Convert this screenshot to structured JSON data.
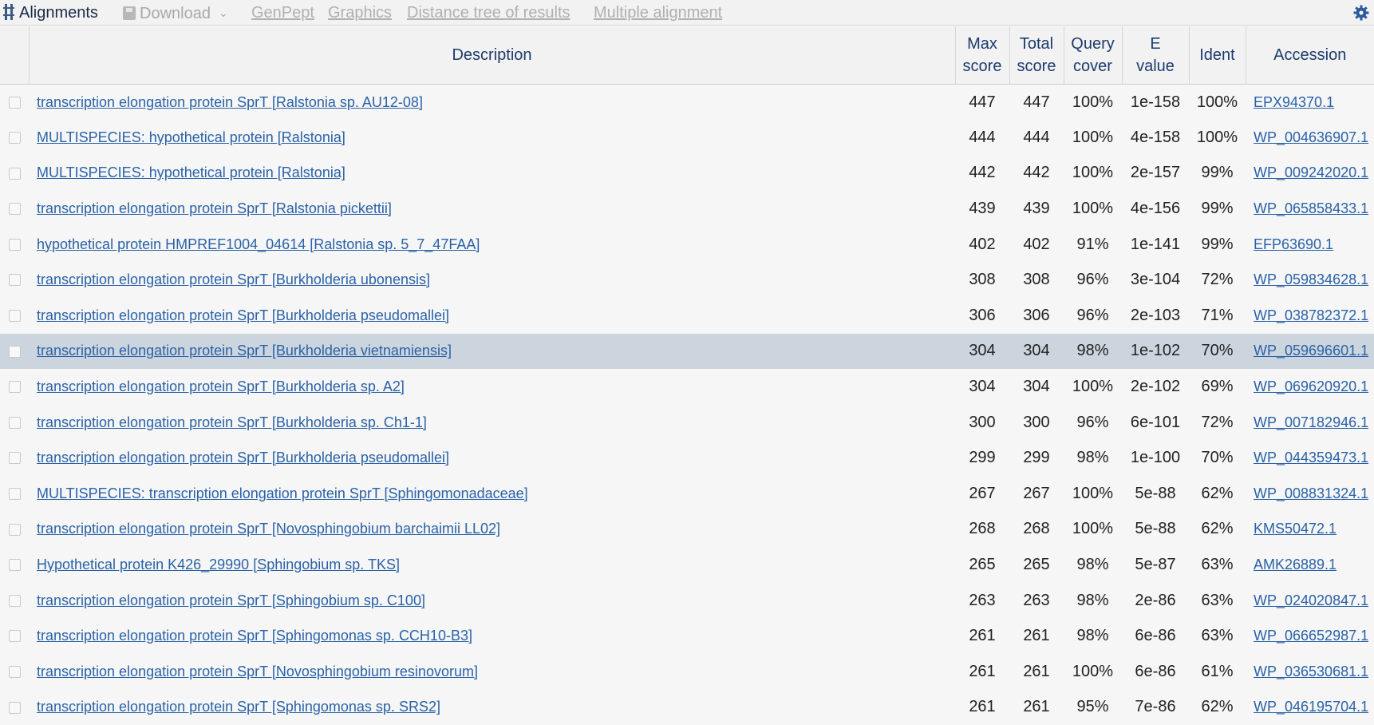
{
  "toolbar": {
    "title": "Alignments",
    "download": "Download",
    "links": [
      "GenPept",
      "Graphics",
      "Distance tree of results",
      "Multiple alignment"
    ]
  },
  "columns": {
    "description": "Description",
    "max_score": [
      "Max",
      "score"
    ],
    "total_score": [
      "Total",
      "score"
    ],
    "query_cover": [
      "Query",
      "cover"
    ],
    "e_value": [
      "E",
      "value"
    ],
    "ident": "Ident",
    "accession": "Accession"
  },
  "colors": {
    "link": "#2a62a8",
    "header_text": "#1d3b6e",
    "highlight_row": "#ccd5de"
  },
  "rows": [
    {
      "description": "transcription elongation protein SprT [Ralstonia sp. AU12-08]",
      "max": "447",
      "total": "447",
      "cover": "100%",
      "evalue": "1e-158",
      "ident": "100%",
      "accession": "EPX94370.1"
    },
    {
      "description": "MULTISPECIES: hypothetical protein [Ralstonia]",
      "max": "444",
      "total": "444",
      "cover": "100%",
      "evalue": "4e-158",
      "ident": "100%",
      "accession": "WP_004636907.1"
    },
    {
      "description": "MULTISPECIES: hypothetical protein [Ralstonia]",
      "max": "442",
      "total": "442",
      "cover": "100%",
      "evalue": "2e-157",
      "ident": "99%",
      "accession": "WP_009242020.1"
    },
    {
      "description": "transcription elongation protein SprT [Ralstonia pickettii]",
      "max": "439",
      "total": "439",
      "cover": "100%",
      "evalue": "4e-156",
      "ident": "99%",
      "accession": "WP_065858433.1"
    },
    {
      "description": "hypothetical protein HMPREF1004_04614 [Ralstonia sp. 5_7_47FAA]",
      "max": "402",
      "total": "402",
      "cover": "91%",
      "evalue": "1e-141",
      "ident": "99%",
      "accession": "EFP63690.1"
    },
    {
      "description": "transcription elongation protein SprT [Burkholderia ubonensis]",
      "max": "308",
      "total": "308",
      "cover": "96%",
      "evalue": "3e-104",
      "ident": "72%",
      "accession": "WP_059834628.1"
    },
    {
      "description": "transcription elongation protein SprT [Burkholderia pseudomallei]",
      "max": "306",
      "total": "306",
      "cover": "96%",
      "evalue": "2e-103",
      "ident": "71%",
      "accession": "WP_038782372.1"
    },
    {
      "description": "transcription elongation protein SprT [Burkholderia vietnamiensis]",
      "max": "304",
      "total": "304",
      "cover": "98%",
      "evalue": "1e-102",
      "ident": "70%",
      "accession": "WP_059696601.1",
      "highlight": true
    },
    {
      "description": "transcription elongation protein SprT [Burkholderia sp. A2]",
      "max": "304",
      "total": "304",
      "cover": "100%",
      "evalue": "2e-102",
      "ident": "69%",
      "accession": "WP_069620920.1"
    },
    {
      "description": "transcription elongation protein SprT [Burkholderia sp. Ch1-1]",
      "max": "300",
      "total": "300",
      "cover": "96%",
      "evalue": "6e-101",
      "ident": "72%",
      "accession": "WP_007182946.1"
    },
    {
      "description": "transcription elongation protein SprT [Burkholderia pseudomallei]",
      "max": "299",
      "total": "299",
      "cover": "98%",
      "evalue": "1e-100",
      "ident": "70%",
      "accession": "WP_044359473.1"
    },
    {
      "description": "MULTISPECIES: transcription elongation protein SprT [Sphingomonadaceae]",
      "max": "267",
      "total": "267",
      "cover": "100%",
      "evalue": "5e-88",
      "ident": "62%",
      "accession": "WP_008831324.1"
    },
    {
      "description": "transcription elongation protein SprT [Novosphingobium barchaimii LL02]",
      "max": "268",
      "total": "268",
      "cover": "100%",
      "evalue": "5e-88",
      "ident": "62%",
      "accession": "KMS50472.1"
    },
    {
      "description": "Hypothetical protein K426_29990 [Sphingobium sp. TKS]",
      "max": "265",
      "total": "265",
      "cover": "98%",
      "evalue": "5e-87",
      "ident": "63%",
      "accession": "AMK26889.1"
    },
    {
      "description": "transcription elongation protein SprT [Sphingobium sp. C100]",
      "max": "263",
      "total": "263",
      "cover": "98%",
      "evalue": "2e-86",
      "ident": "63%",
      "accession": "WP_024020847.1"
    },
    {
      "description": "transcription elongation protein SprT [Sphingomonas sp. CCH10-B3]",
      "max": "261",
      "total": "261",
      "cover": "98%",
      "evalue": "6e-86",
      "ident": "63%",
      "accession": "WP_066652987.1"
    },
    {
      "description": "transcription elongation protein SprT [Novosphingobium resinovorum]",
      "max": "261",
      "total": "261",
      "cover": "100%",
      "evalue": "6e-86",
      "ident": "61%",
      "accession": "WP_036530681.1"
    },
    {
      "description": "transcription elongation protein SprT [Sphingomonas sp. SRS2]",
      "max": "261",
      "total": "261",
      "cover": "95%",
      "evalue": "7e-86",
      "ident": "62%",
      "accession": "WP_046195704.1"
    }
  ]
}
